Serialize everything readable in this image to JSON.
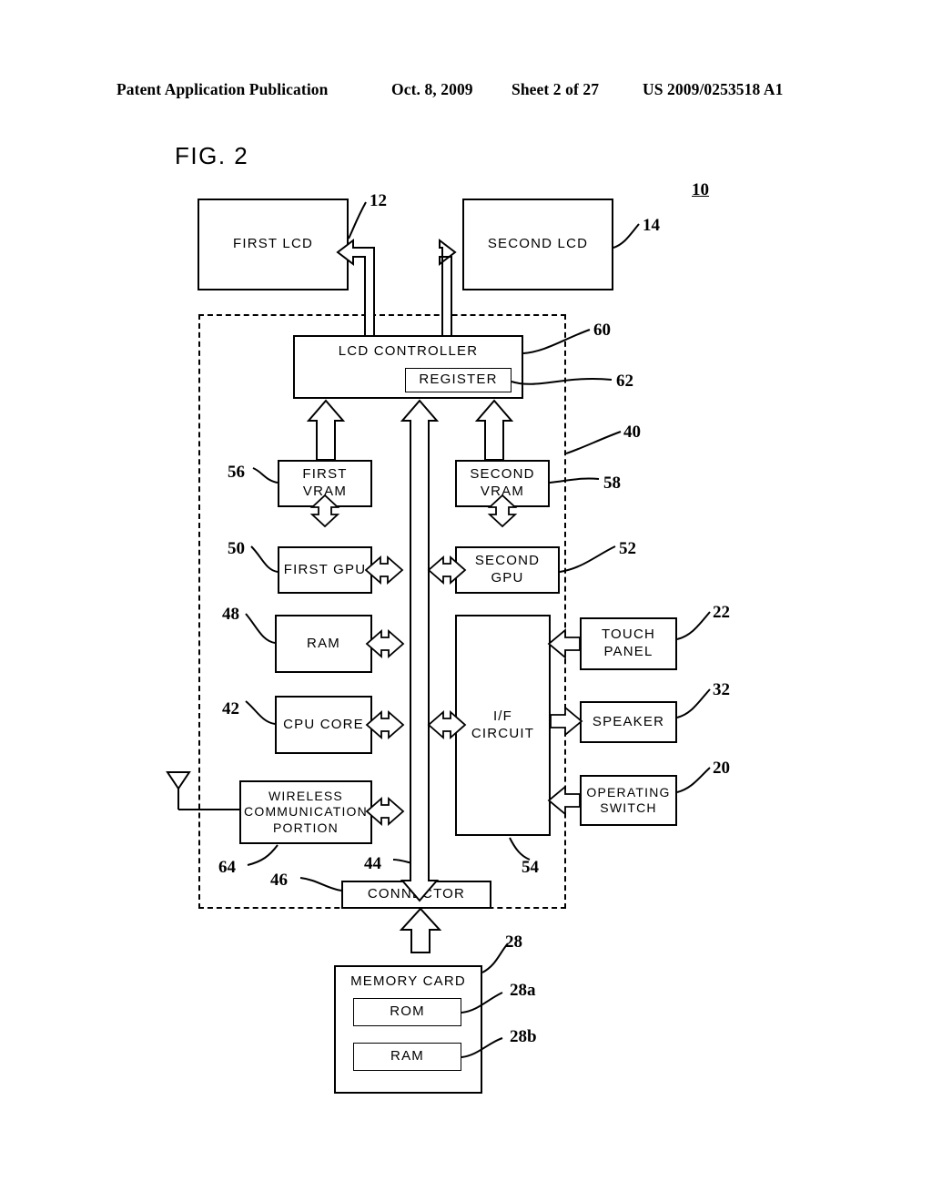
{
  "header": {
    "publication": "Patent Application Publication",
    "date": "Oct. 8, 2009",
    "sheet": "Sheet 2 of 27",
    "number": "US 2009/0253518 A1"
  },
  "figure": {
    "label": "FIG. 2",
    "system_ref": "10"
  },
  "blocks": {
    "first_lcd": {
      "label": "FIRST LCD",
      "ref": "12"
    },
    "second_lcd": {
      "label": "SECOND LCD",
      "ref": "14"
    },
    "lcd_controller": {
      "label": "LCD CONTROLLER",
      "ref": "60"
    },
    "register": {
      "label": "REGISTER",
      "ref": "62"
    },
    "first_vram": {
      "label": "FIRST\nVRAM",
      "ref": "56"
    },
    "second_vram": {
      "label": "SECOND\nVRAM",
      "ref": "58"
    },
    "first_gpu": {
      "label": "FIRST GPU",
      "ref": "50"
    },
    "second_gpu": {
      "label": "SECOND GPU",
      "ref": "52"
    },
    "ram": {
      "label": "RAM",
      "ref": "48"
    },
    "cpu_core": {
      "label": "CPU CORE",
      "ref": "42"
    },
    "wireless": {
      "label": "WIRELESS\nCOMMUNICATION\nPORTION",
      "ref": "64"
    },
    "if_circuit": {
      "label": "I/F\nCIRCUIT",
      "ref": "54"
    },
    "touch_panel": {
      "label": "TOUCH\nPANEL",
      "ref": "22"
    },
    "speaker": {
      "label": "SPEAKER",
      "ref": "32"
    },
    "operating_switch": {
      "label": "OPERATING\nSWITCH",
      "ref": "20"
    },
    "connector": {
      "label": "CONNECTOR",
      "ref": "46"
    },
    "bus": {
      "ref": "44"
    },
    "electronic_circuit_board": {
      "ref": "40"
    },
    "memory_card": {
      "label": "MEMORY CARD",
      "ref": "28"
    },
    "card_rom": {
      "label": "ROM",
      "ref": "28a"
    },
    "card_ram": {
      "label": "RAM",
      "ref": "28b"
    }
  }
}
